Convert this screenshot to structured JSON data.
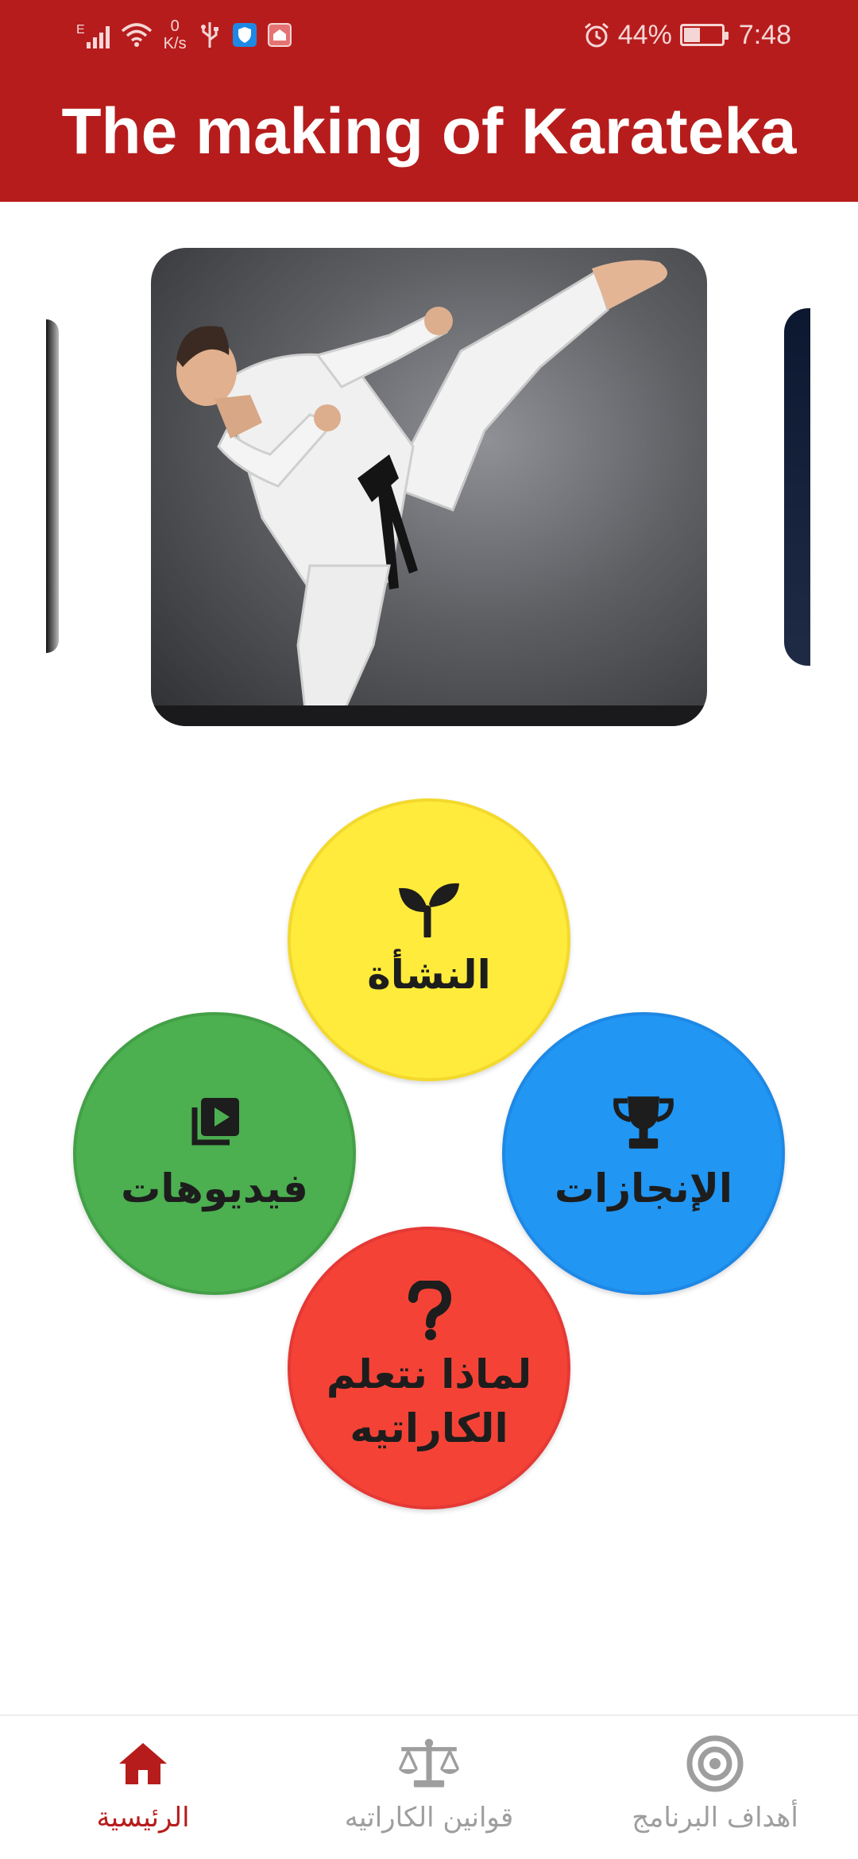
{
  "colors": {
    "brand": "#b71c1c",
    "yellow": "#ffeb3b",
    "green": "#4caf50",
    "blue": "#2196f3",
    "red": "#f44336",
    "nav_inactive": "#9e9e9e"
  },
  "status_bar": {
    "network": "E",
    "speed_value": "0",
    "speed_unit": "K/s",
    "battery": "44%",
    "battery_level": 0.44,
    "time": "7:48"
  },
  "header": {
    "title": "The making of Karateka"
  },
  "carousel": {
    "slides_visible": 3,
    "active_image": "karate-kick-photo"
  },
  "menu": {
    "origin": {
      "label": "النشأة",
      "icon": "sprout-icon"
    },
    "videos": {
      "label": "فيديوهات",
      "icon": "video-library-icon"
    },
    "achievements": {
      "label": "الإنجازات",
      "icon": "trophy-icon"
    },
    "why_learn": {
      "label_line1": "لماذا نتعلم",
      "label_line2": "الكاراتيه",
      "icon": "question-mark-icon"
    }
  },
  "bottom_nav": {
    "home": "الرئيسية",
    "rules": "قوانين الكاراتيه",
    "goals": "أهداف البرنامج",
    "active": "home"
  }
}
